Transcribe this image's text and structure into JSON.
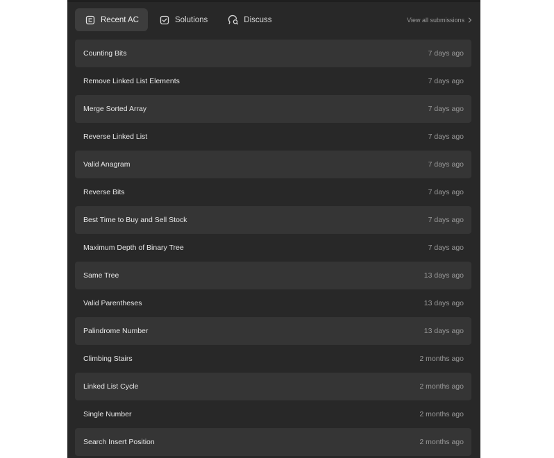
{
  "tabs": [
    {
      "label": "Recent AC",
      "icon": "list-icon",
      "active": true
    },
    {
      "label": "Solutions",
      "icon": "checkbox-icon",
      "active": false
    },
    {
      "label": "Discuss",
      "icon": "discuss-icon",
      "active": false
    }
  ],
  "view_all_label": "View all submissions",
  "submissions": [
    {
      "title": "Counting Bits",
      "time": "7 days ago"
    },
    {
      "title": "Remove Linked List Elements",
      "time": "7 days ago"
    },
    {
      "title": "Merge Sorted Array",
      "time": "7 days ago"
    },
    {
      "title": "Reverse Linked List",
      "time": "7 days ago"
    },
    {
      "title": "Valid Anagram",
      "time": "7 days ago"
    },
    {
      "title": "Reverse Bits",
      "time": "7 days ago"
    },
    {
      "title": "Best Time to Buy and Sell Stock",
      "time": "7 days ago"
    },
    {
      "title": "Maximum Depth of Binary Tree",
      "time": "7 days ago"
    },
    {
      "title": "Same Tree",
      "time": "13 days ago"
    },
    {
      "title": "Valid Parentheses",
      "time": "13 days ago"
    },
    {
      "title": "Palindrome Number",
      "time": "13 days ago"
    },
    {
      "title": "Climbing Stairs",
      "time": "2 months ago"
    },
    {
      "title": "Linked List Cycle",
      "time": "2 months ago"
    },
    {
      "title": "Single Number",
      "time": "2 months ago"
    },
    {
      "title": "Search Insert Position",
      "time": "2 months ago"
    }
  ]
}
